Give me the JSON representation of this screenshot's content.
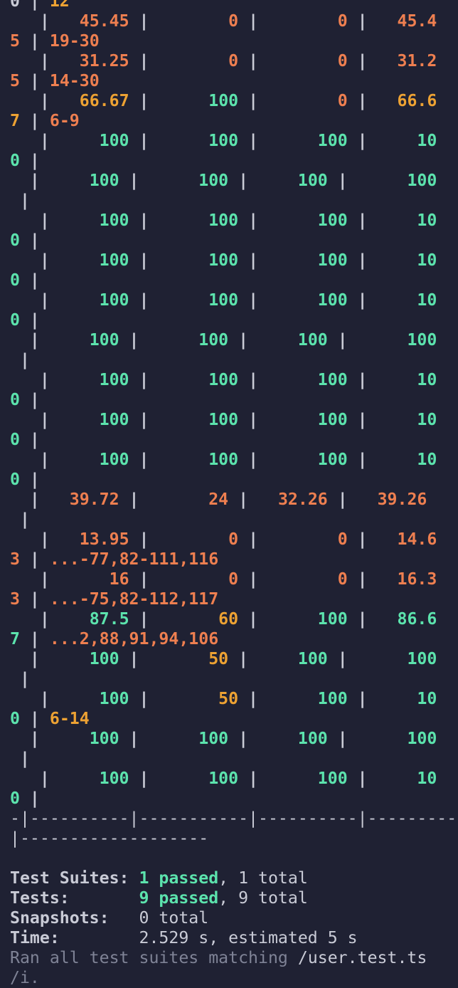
{
  "terminal": {
    "lines": [
      [
        {
          "t": "0 | ",
          "c": "w"
        },
        {
          "t": "12",
          "c": "y"
        }
      ],
      [
        {
          "t": "   |   ",
          "c": "w"
        },
        {
          "t": "45.45",
          "c": "o"
        },
        {
          "t": " |        ",
          "c": "w"
        },
        {
          "t": "0",
          "c": "o"
        },
        {
          "t": " |        ",
          "c": "w"
        },
        {
          "t": "0",
          "c": "o"
        },
        {
          "t": " |   ",
          "c": "w"
        },
        {
          "t": "45.4",
          "c": "o"
        }
      ],
      [
        {
          "t": "5",
          "c": "o"
        },
        {
          "t": " | ",
          "c": "w"
        },
        {
          "t": "19-30",
          "c": "o"
        }
      ],
      [
        {
          "t": "   |   ",
          "c": "w"
        },
        {
          "t": "31.25",
          "c": "o"
        },
        {
          "t": " |        ",
          "c": "w"
        },
        {
          "t": "0",
          "c": "o"
        },
        {
          "t": " |        ",
          "c": "w"
        },
        {
          "t": "0",
          "c": "o"
        },
        {
          "t": " |   ",
          "c": "w"
        },
        {
          "t": "31.2",
          "c": "o"
        }
      ],
      [
        {
          "t": "5",
          "c": "o"
        },
        {
          "t": " | ",
          "c": "w"
        },
        {
          "t": "14-30",
          "c": "o"
        }
      ],
      [
        {
          "t": "   |   ",
          "c": "w"
        },
        {
          "t": "66.67",
          "c": "y"
        },
        {
          "t": " |      ",
          "c": "w"
        },
        {
          "t": "100",
          "c": "g"
        },
        {
          "t": " |        ",
          "c": "w"
        },
        {
          "t": "0",
          "c": "o"
        },
        {
          "t": " |   ",
          "c": "w"
        },
        {
          "t": "66.6",
          "c": "y"
        }
      ],
      [
        {
          "t": "7",
          "c": "y"
        },
        {
          "t": " | ",
          "c": "w"
        },
        {
          "t": "6-9",
          "c": "o"
        }
      ],
      [
        {
          "t": "   |     ",
          "c": "w"
        },
        {
          "t": "100",
          "c": "g"
        },
        {
          "t": " |      ",
          "c": "w"
        },
        {
          "t": "100",
          "c": "g"
        },
        {
          "t": " |      ",
          "c": "w"
        },
        {
          "t": "100",
          "c": "g"
        },
        {
          "t": " |     ",
          "c": "w"
        },
        {
          "t": "10",
          "c": "g"
        }
      ],
      [
        {
          "t": "0",
          "c": "g"
        },
        {
          "t": " |",
          "c": "w"
        }
      ],
      [
        {
          "t": "  |     ",
          "c": "w"
        },
        {
          "t": "100",
          "c": "g"
        },
        {
          "t": " |      ",
          "c": "w"
        },
        {
          "t": "100",
          "c": "g"
        },
        {
          "t": " |     ",
          "c": "w"
        },
        {
          "t": "100",
          "c": "g"
        },
        {
          "t": " |      ",
          "c": "w"
        },
        {
          "t": "100",
          "c": "g"
        }
      ],
      [
        {
          "t": " |",
          "c": "w"
        }
      ],
      [
        {
          "t": "   |     ",
          "c": "w"
        },
        {
          "t": "100",
          "c": "g"
        },
        {
          "t": " |      ",
          "c": "w"
        },
        {
          "t": "100",
          "c": "g"
        },
        {
          "t": " |      ",
          "c": "w"
        },
        {
          "t": "100",
          "c": "g"
        },
        {
          "t": " |     ",
          "c": "w"
        },
        {
          "t": "10",
          "c": "g"
        }
      ],
      [
        {
          "t": "0",
          "c": "g"
        },
        {
          "t": " |",
          "c": "w"
        }
      ],
      [
        {
          "t": "   |     ",
          "c": "w"
        },
        {
          "t": "100",
          "c": "g"
        },
        {
          "t": " |      ",
          "c": "w"
        },
        {
          "t": "100",
          "c": "g"
        },
        {
          "t": " |      ",
          "c": "w"
        },
        {
          "t": "100",
          "c": "g"
        },
        {
          "t": " |     ",
          "c": "w"
        },
        {
          "t": "10",
          "c": "g"
        }
      ],
      [
        {
          "t": "0",
          "c": "g"
        },
        {
          "t": " |",
          "c": "w"
        }
      ],
      [
        {
          "t": "   |     ",
          "c": "w"
        },
        {
          "t": "100",
          "c": "g"
        },
        {
          "t": " |      ",
          "c": "w"
        },
        {
          "t": "100",
          "c": "g"
        },
        {
          "t": " |      ",
          "c": "w"
        },
        {
          "t": "100",
          "c": "g"
        },
        {
          "t": " |     ",
          "c": "w"
        },
        {
          "t": "10",
          "c": "g"
        }
      ],
      [
        {
          "t": "0",
          "c": "g"
        },
        {
          "t": " |",
          "c": "w"
        }
      ],
      [
        {
          "t": "  |     ",
          "c": "w"
        },
        {
          "t": "100",
          "c": "g"
        },
        {
          "t": " |      ",
          "c": "w"
        },
        {
          "t": "100",
          "c": "g"
        },
        {
          "t": " |     ",
          "c": "w"
        },
        {
          "t": "100",
          "c": "g"
        },
        {
          "t": " |      ",
          "c": "w"
        },
        {
          "t": "100",
          "c": "g"
        }
      ],
      [
        {
          "t": " |",
          "c": "w"
        }
      ],
      [
        {
          "t": "   |     ",
          "c": "w"
        },
        {
          "t": "100",
          "c": "g"
        },
        {
          "t": " |      ",
          "c": "w"
        },
        {
          "t": "100",
          "c": "g"
        },
        {
          "t": " |      ",
          "c": "w"
        },
        {
          "t": "100",
          "c": "g"
        },
        {
          "t": " |     ",
          "c": "w"
        },
        {
          "t": "10",
          "c": "g"
        }
      ],
      [
        {
          "t": "0",
          "c": "g"
        },
        {
          "t": " |",
          "c": "w"
        }
      ],
      [
        {
          "t": "   |     ",
          "c": "w"
        },
        {
          "t": "100",
          "c": "g"
        },
        {
          "t": " |      ",
          "c": "w"
        },
        {
          "t": "100",
          "c": "g"
        },
        {
          "t": " |      ",
          "c": "w"
        },
        {
          "t": "100",
          "c": "g"
        },
        {
          "t": " |     ",
          "c": "w"
        },
        {
          "t": "10",
          "c": "g"
        }
      ],
      [
        {
          "t": "0",
          "c": "g"
        },
        {
          "t": " |",
          "c": "w"
        }
      ],
      [
        {
          "t": "   |     ",
          "c": "w"
        },
        {
          "t": "100",
          "c": "g"
        },
        {
          "t": " |      ",
          "c": "w"
        },
        {
          "t": "100",
          "c": "g"
        },
        {
          "t": " |      ",
          "c": "w"
        },
        {
          "t": "100",
          "c": "g"
        },
        {
          "t": " |     ",
          "c": "w"
        },
        {
          "t": "10",
          "c": "g"
        }
      ],
      [
        {
          "t": "0",
          "c": "g"
        },
        {
          "t": " |",
          "c": "w"
        }
      ],
      [
        {
          "t": "  |   ",
          "c": "w"
        },
        {
          "t": "39.72",
          "c": "o"
        },
        {
          "t": " |       ",
          "c": "w"
        },
        {
          "t": "24",
          "c": "o"
        },
        {
          "t": " |   ",
          "c": "w"
        },
        {
          "t": "32.26",
          "c": "o"
        },
        {
          "t": " |   ",
          "c": "w"
        },
        {
          "t": "39.26",
          "c": "o"
        }
      ],
      [
        {
          "t": " |",
          "c": "w"
        }
      ],
      [
        {
          "t": "   |   ",
          "c": "w"
        },
        {
          "t": "13.95",
          "c": "o"
        },
        {
          "t": " |        ",
          "c": "w"
        },
        {
          "t": "0",
          "c": "o"
        },
        {
          "t": " |        ",
          "c": "w"
        },
        {
          "t": "0",
          "c": "o"
        },
        {
          "t": " |   ",
          "c": "w"
        },
        {
          "t": "14.6",
          "c": "o"
        }
      ],
      [
        {
          "t": "3",
          "c": "o"
        },
        {
          "t": " | ",
          "c": "w"
        },
        {
          "t": "...-77,82-111,116",
          "c": "o"
        }
      ],
      [
        {
          "t": "   |      ",
          "c": "w"
        },
        {
          "t": "16",
          "c": "o"
        },
        {
          "t": " |        ",
          "c": "w"
        },
        {
          "t": "0",
          "c": "o"
        },
        {
          "t": " |        ",
          "c": "w"
        },
        {
          "t": "0",
          "c": "o"
        },
        {
          "t": " |   ",
          "c": "w"
        },
        {
          "t": "16.3",
          "c": "o"
        }
      ],
      [
        {
          "t": "3",
          "c": "o"
        },
        {
          "t": " | ",
          "c": "w"
        },
        {
          "t": "...-75,82-112,117",
          "c": "o"
        }
      ],
      [
        {
          "t": "   |    ",
          "c": "w"
        },
        {
          "t": "87.5",
          "c": "g"
        },
        {
          "t": " |       ",
          "c": "w"
        },
        {
          "t": "60",
          "c": "y"
        },
        {
          "t": " |      ",
          "c": "w"
        },
        {
          "t": "100",
          "c": "g"
        },
        {
          "t": " |   ",
          "c": "w"
        },
        {
          "t": "86.6",
          "c": "g"
        }
      ],
      [
        {
          "t": "7",
          "c": "g"
        },
        {
          "t": " | ",
          "c": "w"
        },
        {
          "t": "...2,88,91,94,106",
          "c": "o"
        }
      ],
      [
        {
          "t": "  |     ",
          "c": "w"
        },
        {
          "t": "100",
          "c": "g"
        },
        {
          "t": " |       ",
          "c": "w"
        },
        {
          "t": "50",
          "c": "y"
        },
        {
          "t": " |     ",
          "c": "w"
        },
        {
          "t": "100",
          "c": "g"
        },
        {
          "t": " |      ",
          "c": "w"
        },
        {
          "t": "100",
          "c": "g"
        }
      ],
      [
        {
          "t": " |",
          "c": "w"
        }
      ],
      [
        {
          "t": "   |     ",
          "c": "w"
        },
        {
          "t": "100",
          "c": "g"
        },
        {
          "t": " |       ",
          "c": "w"
        },
        {
          "t": "50",
          "c": "y"
        },
        {
          "t": " |      ",
          "c": "w"
        },
        {
          "t": "100",
          "c": "g"
        },
        {
          "t": " |     ",
          "c": "w"
        },
        {
          "t": "10",
          "c": "g"
        }
      ],
      [
        {
          "t": "0",
          "c": "g"
        },
        {
          "t": " | ",
          "c": "w"
        },
        {
          "t": "6-14",
          "c": "y"
        }
      ],
      [
        {
          "t": "  |     ",
          "c": "w"
        },
        {
          "t": "100",
          "c": "g"
        },
        {
          "t": " |      ",
          "c": "w"
        },
        {
          "t": "100",
          "c": "g"
        },
        {
          "t": " |     ",
          "c": "w"
        },
        {
          "t": "100",
          "c": "g"
        },
        {
          "t": " |      ",
          "c": "w"
        },
        {
          "t": "100",
          "c": "g"
        }
      ],
      [
        {
          "t": " |",
          "c": "w"
        }
      ],
      [
        {
          "t": "   |     ",
          "c": "w"
        },
        {
          "t": "100",
          "c": "g"
        },
        {
          "t": " |      ",
          "c": "w"
        },
        {
          "t": "100",
          "c": "g"
        },
        {
          "t": " |      ",
          "c": "w"
        },
        {
          "t": "100",
          "c": "g"
        },
        {
          "t": " |     ",
          "c": "w"
        },
        {
          "t": "10",
          "c": "g"
        }
      ],
      [
        {
          "t": "0",
          "c": "g"
        },
        {
          "t": " |",
          "c": "w"
        }
      ],
      [
        {
          "t": "-|----------|-----------|----------|---------",
          "c": "wn"
        }
      ],
      [
        {
          "t": "|-------------------",
          "c": "wn"
        }
      ],
      [
        {
          "t": "",
          "c": "w"
        }
      ],
      [
        {
          "t": "Test Suites: ",
          "c": "w"
        },
        {
          "t": "1 passed",
          "c": "g"
        },
        {
          "t": ", 1 total",
          "c": "wn"
        }
      ],
      [
        {
          "t": "Tests:       ",
          "c": "w"
        },
        {
          "t": "9 passed",
          "c": "g"
        },
        {
          "t": ", 9 total",
          "c": "wn"
        }
      ],
      [
        {
          "t": "Snapshots:   ",
          "c": "w"
        },
        {
          "t": "0 total",
          "c": "wn"
        }
      ],
      [
        {
          "t": "Time:        ",
          "c": "w"
        },
        {
          "t": "2.529 s, estimated 5 s",
          "c": "wn"
        }
      ],
      [
        {
          "t": "Ran all test suites matching ",
          "c": "dim"
        },
        {
          "t": "/user.test.ts",
          "c": "wn"
        }
      ],
      [
        {
          "t": "/i.",
          "c": "dim"
        }
      ]
    ]
  },
  "colors": {
    "background": "#1f2133",
    "text": "#c9cbd6",
    "green": "#5ce3ad",
    "orange": "#ee7f50",
    "yellow": "#eda233",
    "dim": "#7f8396"
  }
}
